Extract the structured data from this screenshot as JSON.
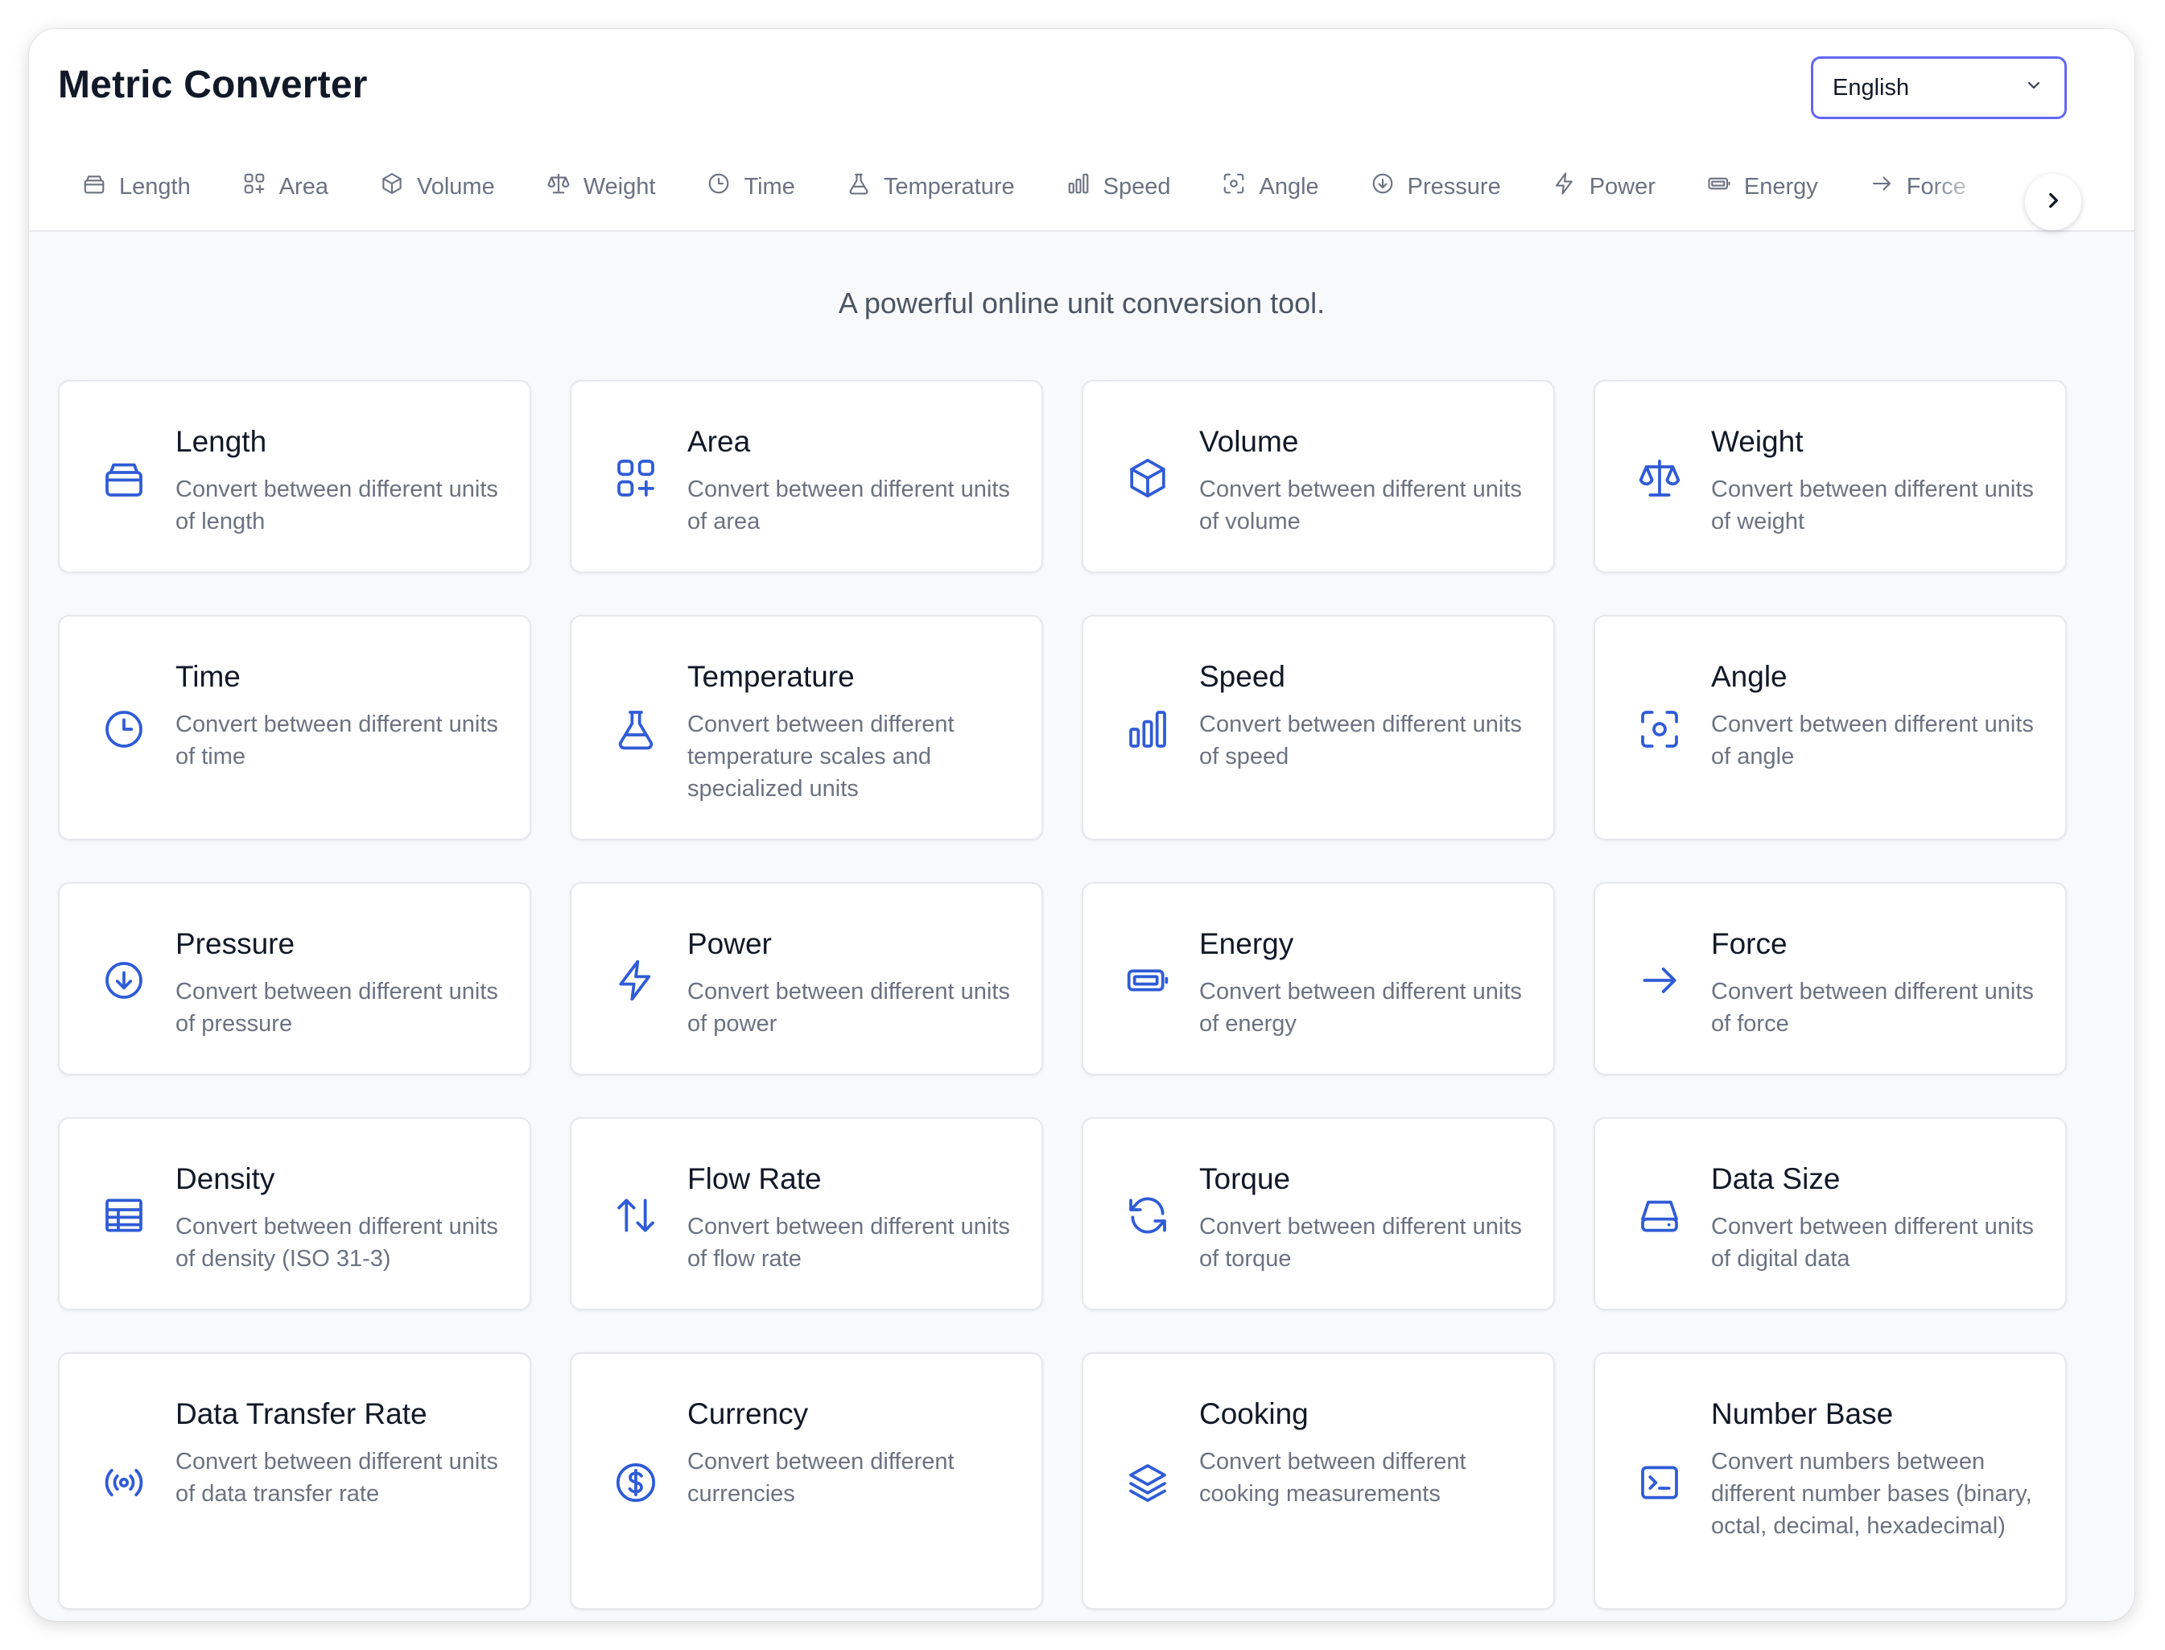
{
  "app": {
    "title": "Metric Converter",
    "language": "English",
    "tagline": "A powerful online unit conversion tool."
  },
  "colors": {
    "accent": "#2f5bd6",
    "select_border": "#6366f1",
    "muted_text": "#6b7280"
  },
  "tabs": [
    {
      "label": "Length",
      "icon": "ruler-icon"
    },
    {
      "label": "Area",
      "icon": "grid-plus-icon"
    },
    {
      "label": "Volume",
      "icon": "cube-icon"
    },
    {
      "label": "Weight",
      "icon": "scale-icon"
    },
    {
      "label": "Time",
      "icon": "clock-icon"
    },
    {
      "label": "Temperature",
      "icon": "flask-icon"
    },
    {
      "label": "Speed",
      "icon": "bar-chart-icon"
    },
    {
      "label": "Angle",
      "icon": "focus-icon"
    },
    {
      "label": "Pressure",
      "icon": "arrow-down-circle-icon"
    },
    {
      "label": "Power",
      "icon": "bolt-icon"
    },
    {
      "label": "Energy",
      "icon": "battery-icon"
    },
    {
      "label": "Force",
      "icon": "arrow-right-icon"
    }
  ],
  "cards": [
    {
      "title": "Length",
      "desc": "Convert between different units of length",
      "icon": "ruler-icon"
    },
    {
      "title": "Area",
      "desc": "Convert between different units of area",
      "icon": "grid-plus-icon"
    },
    {
      "title": "Volume",
      "desc": "Convert between different units of volume",
      "icon": "cube-icon"
    },
    {
      "title": "Weight",
      "desc": "Convert between different units of weight",
      "icon": "scale-icon"
    },
    {
      "title": "Time",
      "desc": "Convert between different units of time",
      "icon": "clock-icon"
    },
    {
      "title": "Temperature",
      "desc": "Convert between different temperature scales and specialized units",
      "icon": "flask-icon"
    },
    {
      "title": "Speed",
      "desc": "Convert between different units of speed",
      "icon": "bar-chart-icon"
    },
    {
      "title": "Angle",
      "desc": "Convert between different units of angle",
      "icon": "focus-icon"
    },
    {
      "title": "Pressure",
      "desc": "Convert between different units of pressure",
      "icon": "arrow-down-circle-icon"
    },
    {
      "title": "Power",
      "desc": "Convert between different units of power",
      "icon": "bolt-icon"
    },
    {
      "title": "Energy",
      "desc": "Convert between different units of energy",
      "icon": "battery-icon"
    },
    {
      "title": "Force",
      "desc": "Convert between different units of force",
      "icon": "arrow-right-icon"
    },
    {
      "title": "Density",
      "desc": "Convert between different units of density (ISO 31-3)",
      "icon": "table-icon"
    },
    {
      "title": "Flow Rate",
      "desc": "Convert between different units of flow rate",
      "icon": "arrows-up-down-icon"
    },
    {
      "title": "Torque",
      "desc": "Convert between different units of torque",
      "icon": "refresh-icon"
    },
    {
      "title": "Data Size",
      "desc": "Convert between different units of digital data",
      "icon": "hard-drive-icon"
    },
    {
      "title": "Data Transfer Rate",
      "desc": "Convert between different units of data transfer rate",
      "icon": "signal-icon"
    },
    {
      "title": "Currency",
      "desc": "Convert between different currencies",
      "icon": "dollar-icon"
    },
    {
      "title": "Cooking",
      "desc": "Convert between different cooking measurements",
      "icon": "layers-icon"
    },
    {
      "title": "Number Base",
      "desc": "Convert numbers between different number bases (binary, octal, decimal, hexadecimal)",
      "icon": "terminal-icon"
    }
  ]
}
